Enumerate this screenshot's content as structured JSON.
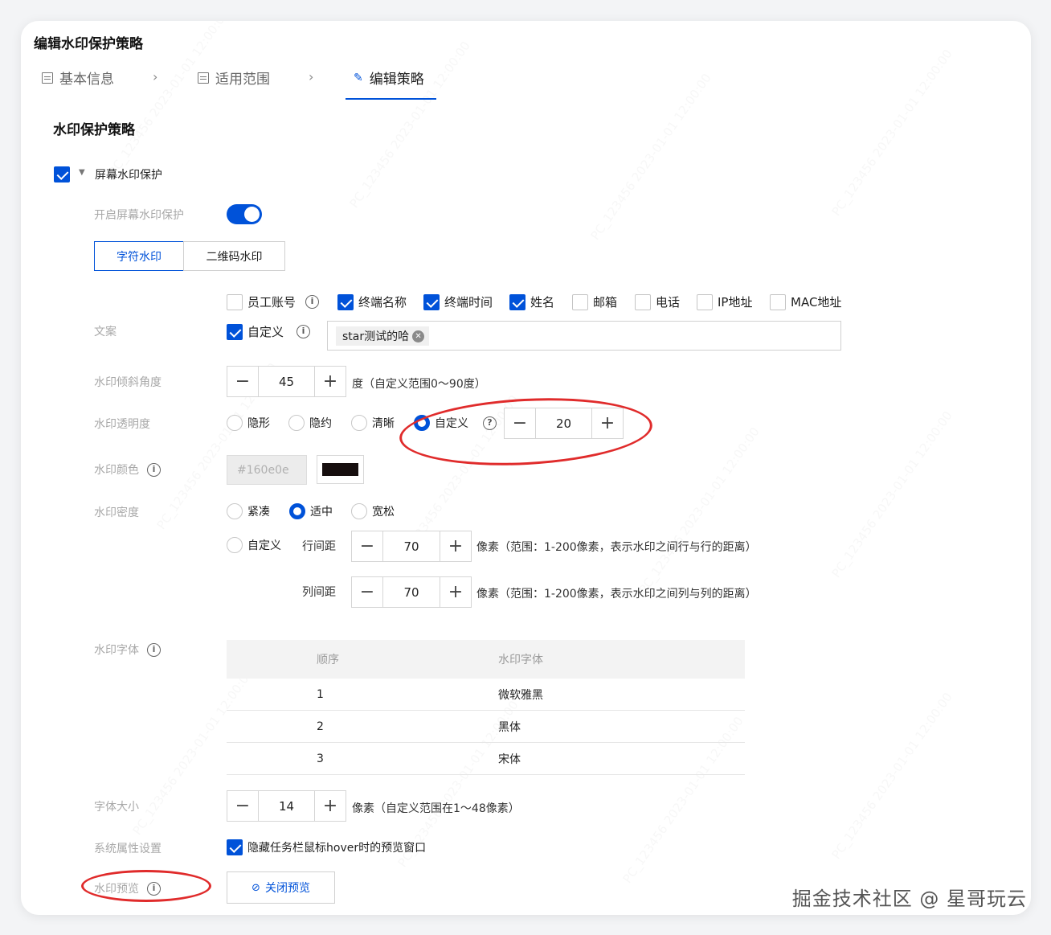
{
  "page": {
    "title": "编辑水印保护策略",
    "steps": [
      {
        "label": "基本信息"
      },
      {
        "label": "适用范围"
      },
      {
        "label": "编辑策略"
      }
    ],
    "section_title": "水印保护策略"
  },
  "screen_wm": {
    "label": "屏幕水印保护",
    "checked": true,
    "enable_label": "开启屏幕水印保护",
    "enabled": true,
    "tabs": [
      {
        "label": "字符水印",
        "active": true
      },
      {
        "label": "二维码水印",
        "active": false
      }
    ]
  },
  "copy": {
    "label": "文案",
    "options": [
      {
        "label": "员工账号",
        "checked": false,
        "help": true
      },
      {
        "label": "终端名称",
        "checked": true
      },
      {
        "label": "终端时间",
        "checked": true
      },
      {
        "label": "姓名",
        "checked": true
      },
      {
        "label": "邮箱",
        "checked": false
      },
      {
        "label": "电话",
        "checked": false
      },
      {
        "label": "IP地址",
        "checked": false
      },
      {
        "label": "MAC地址",
        "checked": false
      }
    ],
    "custom_label": "自定义",
    "custom_checked": true,
    "tag": "star测试的哈"
  },
  "angle": {
    "label": "水印倾斜角度",
    "value": "45",
    "hint": "度（自定义范围0～90度）"
  },
  "opacity": {
    "label": "水印透明度",
    "options": [
      "隐形",
      "隐约",
      "清晰",
      "自定义"
    ],
    "selected": "自定义",
    "value": "20"
  },
  "color": {
    "label": "水印颜色",
    "value": "#160e0e"
  },
  "density": {
    "label": "水印密度",
    "options": [
      "紧凑",
      "适中",
      "宽松"
    ],
    "selected": "适中",
    "custom_label": "自定义",
    "row_spacing_label": "行间距",
    "row_spacing": "70",
    "row_hint": "像素（范围：1-200像素，表示水印之间行与行的距离）",
    "col_spacing_label": "列间距",
    "col_spacing": "70",
    "col_hint": "像素（范围：1-200像素，表示水印之间列与列的距离）"
  },
  "font": {
    "label": "水印字体",
    "columns": [
      "顺序",
      "水印字体"
    ],
    "rows": [
      [
        "1",
        "微软雅黑"
      ],
      [
        "2",
        "黑体"
      ],
      [
        "3",
        "宋体"
      ]
    ]
  },
  "font_size": {
    "label": "字体大小",
    "value": "14",
    "hint": "像素（自定义范围在1～48像素）"
  },
  "system": {
    "label": "系统属性设置",
    "option": "隐藏任务栏鼠标hover时的预览窗口",
    "checked": true
  },
  "preview": {
    "label": "水印预览",
    "button": "关闭预览"
  },
  "credit": "掘金技术社区 @ 星哥玩云",
  "colors": {
    "primary": "#0052d9",
    "annotation": "#e02b2b"
  }
}
